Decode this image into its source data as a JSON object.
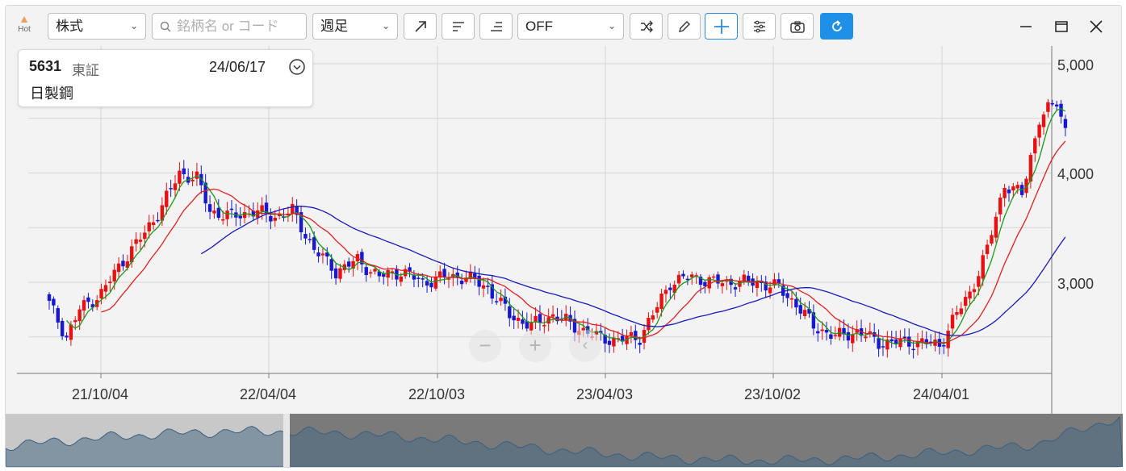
{
  "toolbar": {
    "hot_label": "Hot",
    "asset_type": "株式",
    "search_placeholder": "銘柄名 or コード",
    "period": "週足",
    "indicator": "OFF"
  },
  "stock": {
    "code": "5631",
    "market": "東証",
    "date": "24/06/17",
    "name": "日製鋼"
  },
  "chart_data": {
    "type": "candlestick",
    "period": "weekly",
    "y_ticks": [
      "5,000",
      "4,000",
      "3,000"
    ],
    "x_ticks": [
      "21/10/04",
      "22/04/04",
      "22/10/03",
      "23/04/03",
      "23/10/02",
      "24/04/01"
    ],
    "ylim": [
      2200,
      5100
    ],
    "series": [
      {
        "type": "line",
        "color": "#1a9a1a"
      },
      {
        "type": "line",
        "color": "#e02020"
      },
      {
        "type": "line",
        "color": "#1a1ab8"
      }
    ],
    "colors": {
      "up": "#e81010",
      "down": "#1818d0"
    }
  }
}
